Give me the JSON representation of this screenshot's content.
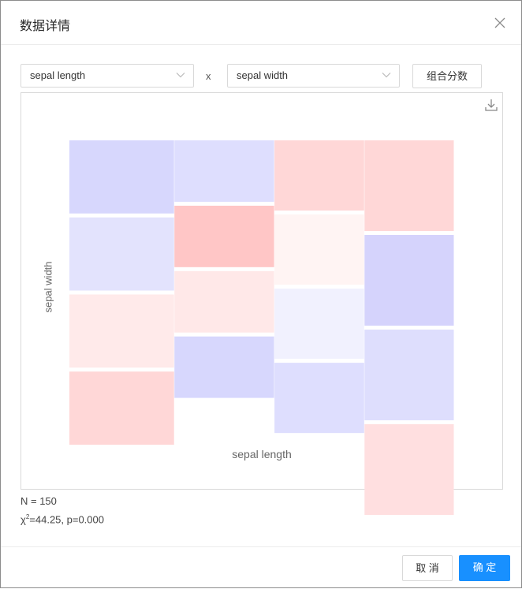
{
  "dialog": {
    "title": "数据详情",
    "close_icon": "close-icon",
    "x_select": {
      "value": "sepal length"
    },
    "separator": "x",
    "y_select": {
      "value": "sepal width"
    },
    "combine_button": "组合分数",
    "download_icon": "download-icon",
    "stats": {
      "n": "N = 150",
      "chi_symbol": "χ",
      "chi_sup": "2",
      "chi_rest": "=44.25, p=0.000"
    },
    "cancel_label": "取 消",
    "ok_label": "确 定",
    "accent": "#1890ff"
  },
  "chart_data": {
    "type": "mosaic",
    "xlabel": "sepal length",
    "ylabel": "sepal width",
    "column_shares": [
      0.273,
      0.26,
      0.234,
      0.233
    ],
    "row_shares_top_to_bottom": [
      [
        0.25,
        0.21,
        0.24,
        0.31
      ],
      [
        0.25,
        0.21,
        0.24,
        0.31
      ],
      [
        0.25,
        0.21,
        0.24,
        0.31
      ],
      [
        0.25,
        0.21,
        0.24,
        0.31
      ]
    ],
    "cell_colors_top_to_bottom": [
      [
        "#d7d7fd",
        "#dedefe",
        "#ffd7d7",
        "#ffd7d7"
      ],
      [
        "#e3e3fd",
        "#ffc6c6",
        "#fff4f3",
        "#d5d3fc"
      ],
      [
        "#ffeaea",
        "#ffe8e8",
        "#f1f1fe",
        "#dedefd"
      ],
      [
        "#ffd7d7",
        "#d7d7fd",
        "#dedefe",
        "#ffdfe0"
      ]
    ],
    "positive_residual_color": "#ff0000",
    "negative_residual_color": "#0000ff",
    "grid": false,
    "legend": "none"
  }
}
